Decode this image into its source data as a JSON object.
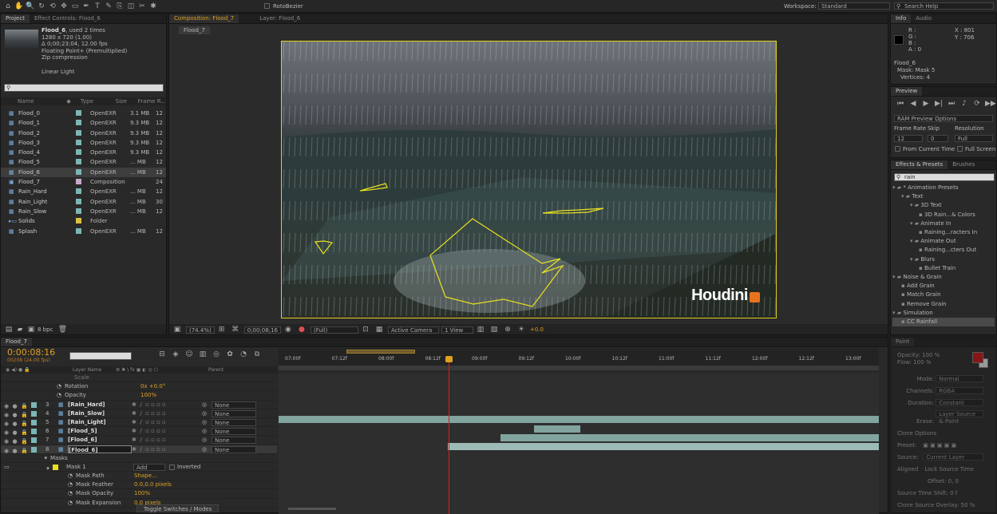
{
  "toolbar": {
    "rotobezier": "RotoBezier",
    "workspace_label": "Workspace:",
    "workspace_value": "Standard",
    "search_help": "Search Help",
    "tools": [
      "home-icon",
      "hand-icon",
      "zoom-icon",
      "rotate-icon",
      "camera-orbit-icon",
      "pan-behind-icon",
      "rectangle-icon",
      "pen-icon",
      "text-icon",
      "brush-icon",
      "clone-icon",
      "eraser-icon",
      "roto-icon",
      "puppet-icon"
    ]
  },
  "project": {
    "tab1": "Project",
    "tab2": "Effect Controls: Flood_6",
    "item_name": "Flood_6",
    "item_used": ", used 2 times",
    "item_size": "1280 x 720 (1.00)",
    "item_duration": "Δ 0;00;23;04, 12.00 fps",
    "item_depth": "Floating Point+ (Premultiplied)",
    "item_compression": "Zip compression",
    "item_blend": "Linear Light",
    "col_name": "Name",
    "col_type": "Type",
    "col_size": "Size",
    "col_frame": "Frame R...",
    "footer": "8 bpc",
    "items": [
      {
        "name": "Flood_0",
        "type": "OpenEXR",
        "size": "3.1 MB",
        "fr": "12"
      },
      {
        "name": "Flood_1",
        "type": "OpenEXR",
        "size": "9.3 MB",
        "fr": "12"
      },
      {
        "name": "Flood_2",
        "type": "OpenEXR",
        "size": "9.3 MB",
        "fr": "12"
      },
      {
        "name": "Flood_3",
        "type": "OpenEXR",
        "size": "9.3 MB",
        "fr": "12"
      },
      {
        "name": "Flood_4",
        "type": "OpenEXR",
        "size": "9.3 MB",
        "fr": "12"
      },
      {
        "name": "Flood_5",
        "type": "OpenEXR",
        "size": "... MB",
        "fr": "12"
      },
      {
        "name": "Flood_6",
        "type": "OpenEXR",
        "size": "... MB",
        "fr": "12"
      },
      {
        "name": "Flood_7",
        "type": "Composition",
        "size": "",
        "fr": "24"
      },
      {
        "name": "Rain_Hard",
        "type": "OpenEXR",
        "size": "... MB",
        "fr": "12"
      },
      {
        "name": "Rain_Light",
        "type": "OpenEXR",
        "size": "... MB",
        "fr": "30"
      },
      {
        "name": "Rain_Slow",
        "type": "OpenEXR",
        "size": "... MB",
        "fr": "12"
      },
      {
        "name": "Solids",
        "type": "Folder",
        "size": "",
        "fr": ""
      },
      {
        "name": "Splash",
        "type": "OpenEXR",
        "size": "... MB",
        "fr": "12"
      }
    ]
  },
  "comp": {
    "tab1": "Composition: Flood_7",
    "tab2": "Layer: Flood_6",
    "sub_tab": "Flood_7",
    "watermark": "Houdini",
    "zoom": "(74.4%)",
    "time": "0;00;08;16",
    "resolution": "(Full)",
    "camera": "Active Camera",
    "view": "1 View",
    "offset": "+0.0"
  },
  "info": {
    "tab1": "Info",
    "tab2": "Audio",
    "r": "R :",
    "g": "G :",
    "b": "B :",
    "a": "A : 0",
    "x": "X : 801",
    "y": "Y : 706",
    "layer": "Flood_6",
    "mask": "Mask: Mask 5",
    "vertices": "Vertices: 4"
  },
  "preview": {
    "tab": "Preview",
    "ram": "RAM Preview Options",
    "frame_rate_label": "Frame Rate",
    "skip_label": "Skip",
    "resolution_label": "Resolution",
    "frame_rate": "12",
    "skip": "0",
    "resolution": "Full",
    "from_current": "From Current Time",
    "full_screen": "Full Screen"
  },
  "effects": {
    "tab1": "Effects & Presets",
    "tab2": "Brushes",
    "search": "rain",
    "tree": [
      {
        "label": "* Animation Presets",
        "indent": 0
      },
      {
        "label": "Text",
        "indent": 1
      },
      {
        "label": "3D Text",
        "indent": 2
      },
      {
        "label": "3D Rain...& Colors",
        "indent": 3
      },
      {
        "label": "Animate In",
        "indent": 2
      },
      {
        "label": "Raining...racters In",
        "indent": 3
      },
      {
        "label": "Animate Out",
        "indent": 2
      },
      {
        "label": "Raining...cters Out",
        "indent": 3
      },
      {
        "label": "Blurs",
        "indent": 2
      },
      {
        "label": "Bullet Train",
        "indent": 3
      },
      {
        "label": "Noise & Grain",
        "indent": 0
      },
      {
        "label": "Add Grain",
        "indent": 1
      },
      {
        "label": "Match Grain",
        "indent": 1
      },
      {
        "label": "Remove Grain",
        "indent": 1
      },
      {
        "label": "Simulation",
        "indent": 0
      },
      {
        "label": "CC Rainfall",
        "indent": 1
      }
    ]
  },
  "paint": {
    "tab": "Paint",
    "opacity": "Opacity: 100 %",
    "flow": "Flow: 100 %",
    "mode_label": "Mode:",
    "mode": "Normal",
    "channels_label": "Channels:",
    "channels": "RGBA",
    "duration_label": "Duration:",
    "duration": "Constant",
    "erase_label": "Erase:",
    "erase": "Layer Source & Paint",
    "clone_options": "Clone Options",
    "preset_label": "Preset:",
    "source_label": "Source:",
    "source": "Current Layer",
    "aligned": "Aligned",
    "lock_source": "Lock Source Time",
    "offset": "Offset: 0, 0",
    "source_time_shift": "Source Time Shift: 0 f",
    "clone_overlay": "Clone Source Overlay: 50 %"
  },
  "timeline": {
    "tab": "Flood_7",
    "time": "0:00:08:16",
    "frame": "00208 (24.00 fps)",
    "col_layer": "Layer Name",
    "col_parent": "Parent",
    "toggle": "Toggle Switches / Modes",
    "ruler": [
      "07:00f",
      "07:12f",
      "08:00f",
      "08:12f",
      "09:00f",
      "09:12f",
      "10:00f",
      "10:12f",
      "11:00f",
      "11:12f",
      "12:00f",
      "12:12f",
      "13:00f"
    ],
    "props": [
      {
        "name": "Rotation",
        "value": "0x +0.0°"
      },
      {
        "name": "Opacity",
        "value": "100%"
      }
    ],
    "layers": [
      {
        "num": "3",
        "name": "[Rain_Hard]",
        "parent": "None"
      },
      {
        "num": "4",
        "name": "[Rain_Slow]",
        "parent": "None"
      },
      {
        "num": "5",
        "name": "[Rain_Light]",
        "parent": "None"
      },
      {
        "num": "6",
        "name": "[Flood_5]",
        "parent": "None"
      },
      {
        "num": "7",
        "name": "[Flood_6]",
        "parent": "None"
      },
      {
        "num": "8",
        "name": "[Flood_6]",
        "parent": "None"
      }
    ],
    "masks": "Masks",
    "mask1": "Mask 1",
    "mode": "Add",
    "inverted": "Inverted",
    "mask_props": [
      {
        "name": "Mask Path",
        "value": "Shape..."
      },
      {
        "name": "Mask Feather",
        "value": "0.0,0.0 pixels"
      },
      {
        "name": "Mask Opacity",
        "value": "100%"
      },
      {
        "name": "Mask Expansion",
        "value": "0.0 pixels"
      }
    ]
  },
  "colors": {
    "accent": "#e0a020",
    "mask": "#e8e020",
    "track": "#8fb8b2",
    "playhead": "#d02020",
    "paint_fg": "#e01010"
  }
}
